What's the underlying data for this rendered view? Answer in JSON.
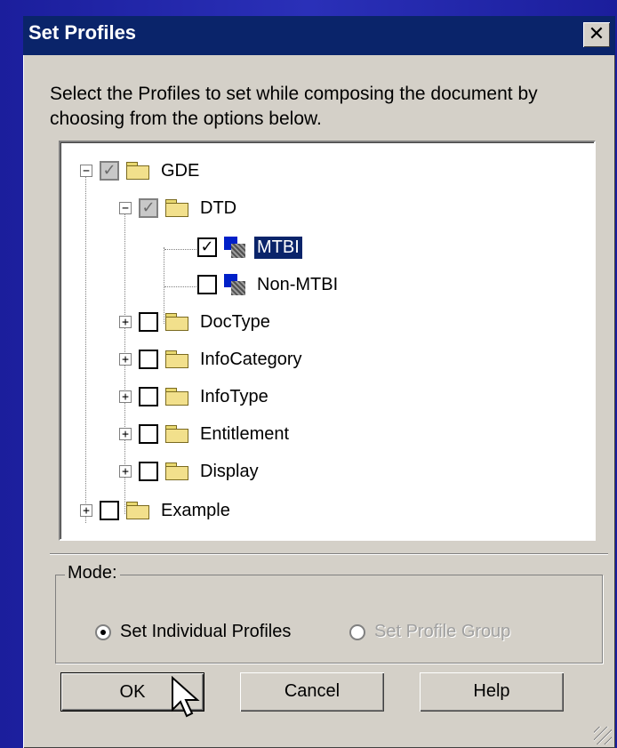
{
  "window": {
    "title": "Set Profiles",
    "close_glyph": "✕"
  },
  "instruction": "Select the Profiles to set while composing the document by choosing from the options below.",
  "tree": {
    "gde": {
      "label": "GDE",
      "expander": "−",
      "check": "✓"
    },
    "dtd": {
      "label": "DTD",
      "expander": "−",
      "check": "✓"
    },
    "mtbi": {
      "label": "MTBI",
      "check": "✓"
    },
    "non_mtbi": {
      "label": "Non-MTBI",
      "check": ""
    },
    "doctype": {
      "label": "DocType",
      "expander": "+"
    },
    "infocategory": {
      "label": "InfoCategory",
      "expander": "+"
    },
    "infotype": {
      "label": "InfoType",
      "expander": "+"
    },
    "entitlement": {
      "label": "Entitlement",
      "expander": "+"
    },
    "display": {
      "label": "Display",
      "expander": "+"
    },
    "example": {
      "label": "Example",
      "expander": "+"
    }
  },
  "mode": {
    "label": "Mode:",
    "individual": "Set Individual Profiles",
    "group": "Set Profile Group"
  },
  "buttons": {
    "ok": "OK",
    "cancel": "Cancel",
    "help": "Help"
  },
  "icons": {
    "folder": "folder-icon",
    "profile": "profile-icon",
    "cursor": "mouse-pointer-icon"
  }
}
